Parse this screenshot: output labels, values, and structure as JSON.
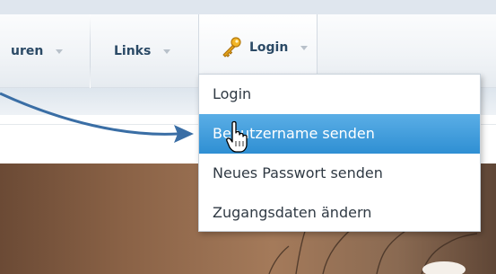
{
  "nav": {
    "items": [
      {
        "label": "uren"
      },
      {
        "label": "Links"
      },
      {
        "label": "Login"
      }
    ]
  },
  "dropdown": {
    "items": [
      {
        "label": "Login",
        "highlighted": false
      },
      {
        "label": "Benutzername senden",
        "highlighted": true
      },
      {
        "label": "Neues Passwort senden",
        "highlighted": false
      },
      {
        "label": "Zugangsdaten ändern",
        "highlighted": false
      }
    ]
  },
  "icons": {
    "login": "key-icon",
    "caret": "chevron-down-icon",
    "pointer": "hand-cursor-icon",
    "annotation": "annotation-arrow"
  },
  "colors": {
    "nav_text": "#2b4a66",
    "highlight": "#2f8fd3",
    "annotation_arrow": "#3a6ea5",
    "key": "#e3a21a"
  }
}
